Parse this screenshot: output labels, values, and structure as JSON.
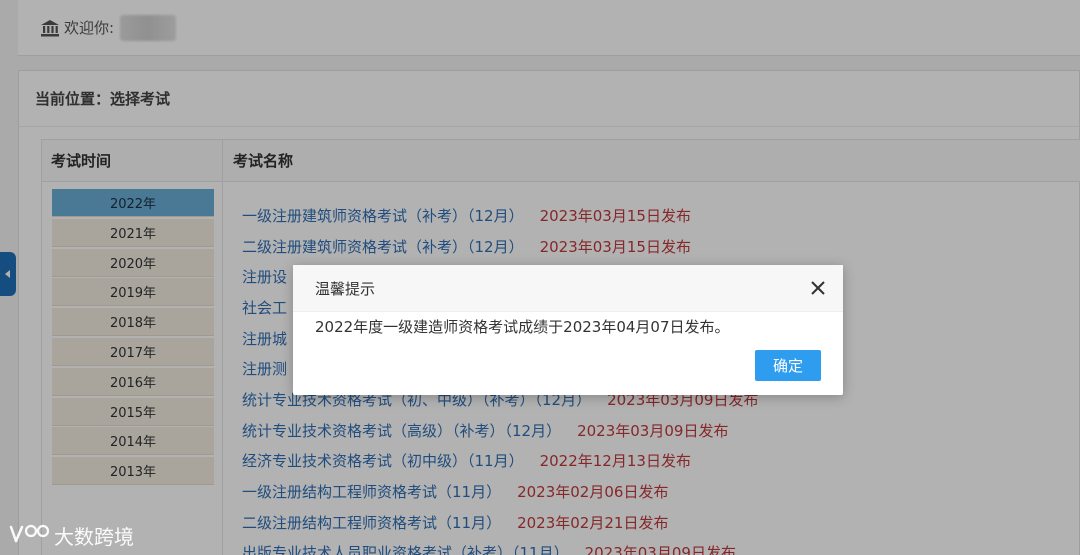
{
  "header": {
    "welcome_text": "欢迎你:",
    "bank_icon": "bank-icon"
  },
  "breadcrumb": "当前位置：选择考试",
  "table": {
    "col_time": "考试时间",
    "col_name": "考试名称"
  },
  "years": [
    {
      "label": "2022年",
      "active": true
    },
    {
      "label": "2021年"
    },
    {
      "label": "2020年"
    },
    {
      "label": "2019年"
    },
    {
      "label": "2018年"
    },
    {
      "label": "2017年"
    },
    {
      "label": "2016年"
    },
    {
      "label": "2015年"
    },
    {
      "label": "2014年"
    },
    {
      "label": "2013年"
    }
  ],
  "exams": [
    {
      "name": "一级注册建筑师资格考试（补考）（12月）",
      "date": "2023年03月15日发布"
    },
    {
      "name": "二级注册建筑师资格考试（补考）（12月）",
      "date": "2023年03月15日发布"
    },
    {
      "name": "注册设",
      "date": ""
    },
    {
      "name": "社会工",
      "date": ""
    },
    {
      "name": "注册城",
      "date": ""
    },
    {
      "name": "注册测",
      "date": ""
    },
    {
      "name": "统计专业技术资格考试（初、中级）（补考）（12月）",
      "date": "2023年03月09日发布"
    },
    {
      "name": "统计专业技术资格考试（高级）（补考）（12月）",
      "date": "2023年03月09日发布"
    },
    {
      "name": "经济专业技术资格考试（初中级）（11月）",
      "date": "2022年12月13日发布"
    },
    {
      "name": "一级注册结构工程师资格考试（11月）",
      "date": "2023年02月06日发布"
    },
    {
      "name": "二级注册结构工程师资格考试（11月）",
      "date": "2023年02月21日发布"
    },
    {
      "name": "出版专业技术人员职业资格考试（补考）（11月）",
      "date": "2023年03月09日发布"
    }
  ],
  "modal": {
    "title": "温馨提示",
    "message": "2022年度一级建造师资格考试成绩于2023年04月07日发布。",
    "ok_label": "确定"
  },
  "watermark": "大数跨境",
  "colors": {
    "link": "#2f6fb5",
    "date": "#c0393b",
    "active_year": "#6aaed6",
    "primary_button": "#2e9df0"
  }
}
